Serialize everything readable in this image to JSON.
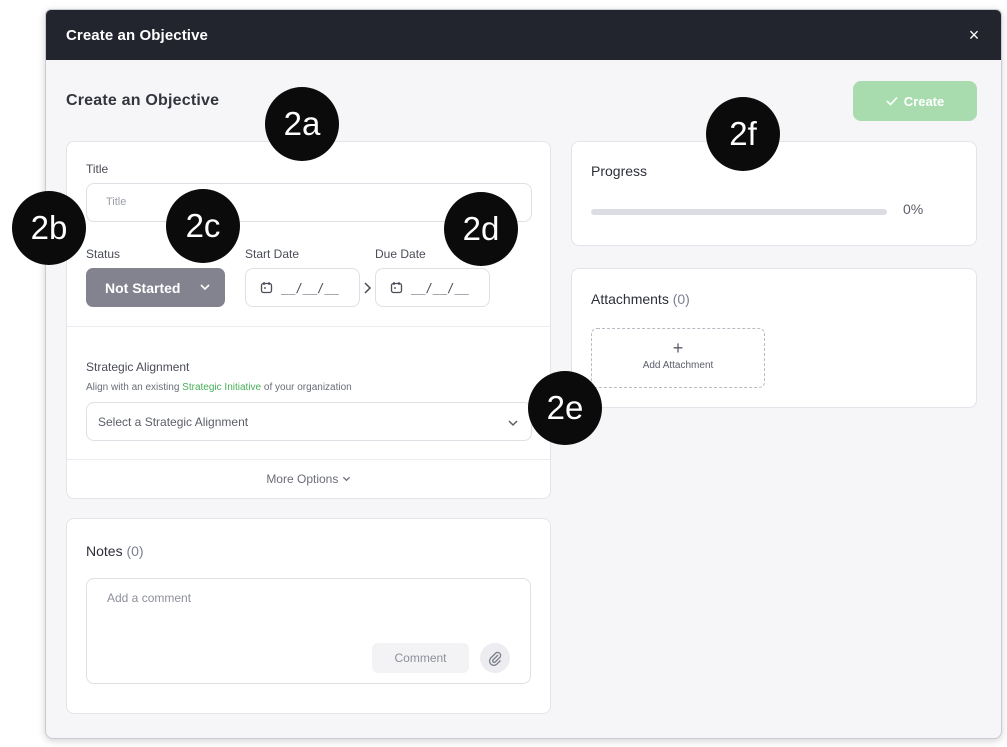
{
  "dialog": {
    "title": "Create an Objective",
    "close_label": "×",
    "heading": "Create an Objective",
    "create_label": "Create"
  },
  "form": {
    "title_label": "Title",
    "title_placeholder": "Title",
    "status_label": "Status",
    "status_value": "Not Started",
    "start_date_label": "Start Date",
    "start_date_value": "__/__/__",
    "due_date_label": "Due Date",
    "due_date_value": "__/__/__",
    "alignment_label": "Strategic Alignment",
    "alignment_hint_pre": "Align with an existing",
    "alignment_hint_link": "Strategic Initiative",
    "alignment_hint_post": "of your organization",
    "alignment_placeholder": "Select a Strategic Alignment",
    "more_options": "More Options"
  },
  "notes": {
    "label": "Notes",
    "count": "(0)",
    "comment_placeholder": "Add a comment",
    "comment_button": "Comment"
  },
  "progress": {
    "label": "Progress",
    "value_text": "0%",
    "fraction": 0
  },
  "attachments": {
    "label": "Attachments",
    "count": "(0)",
    "add_label": "Add Attachment"
  },
  "annotations": [
    "2a",
    "2b",
    "2c",
    "2d",
    "2e",
    "2f"
  ],
  "colors": {
    "titlebar": "#22252e",
    "create_button": "#a8dcae",
    "status_button": "#82838f",
    "link_green": "#47b05a"
  }
}
